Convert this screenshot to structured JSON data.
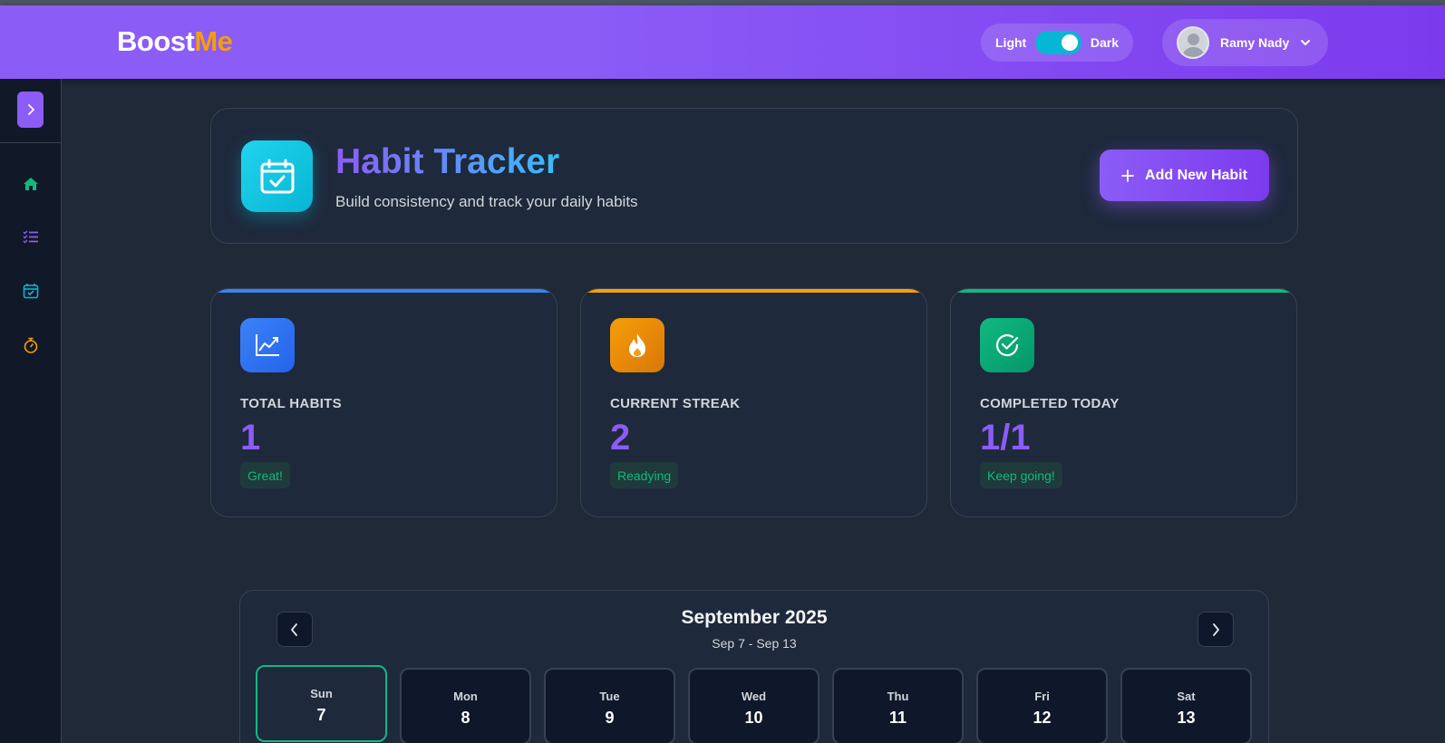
{
  "header": {
    "logo_main": "Boost",
    "logo_accent": "Me",
    "theme_light_label": "Light",
    "theme_dark_label": "Dark",
    "user_name": "Ramy Nady"
  },
  "sidebar": {
    "items": [
      {
        "icon": "home-icon",
        "color": "#10b981"
      },
      {
        "icon": "checklist-icon",
        "color": "#8b5cf6"
      },
      {
        "icon": "calendar-check-icon",
        "color": "#06b6d4"
      },
      {
        "icon": "stopwatch-icon",
        "color": "#f59e0b"
      }
    ]
  },
  "page": {
    "title": "Habit Tracker",
    "subtitle": "Build consistency and track your daily habits",
    "add_button_label": "Add New Habit"
  },
  "stats": [
    {
      "label": "TOTAL HABITS",
      "value": "1",
      "badge": "Great!",
      "icon": "trending-chart-icon",
      "accent": "#3b82f6"
    },
    {
      "label": "CURRENT STREAK",
      "value": "2",
      "badge": "Readying",
      "icon": "flame-icon",
      "accent": "#f59e0b"
    },
    {
      "label": "COMPLETED TODAY",
      "value": "1/1",
      "badge": "Keep going!",
      "icon": "check-circle-icon",
      "accent": "#10b981"
    }
  ],
  "calendar": {
    "month": "September 2025",
    "range": "Sep 7 - Sep 13",
    "days": [
      {
        "name": "Sun",
        "num": "7",
        "selected": true
      },
      {
        "name": "Mon",
        "num": "8"
      },
      {
        "name": "Tue",
        "num": "9"
      },
      {
        "name": "Wed",
        "num": "10"
      },
      {
        "name": "Thu",
        "num": "11"
      },
      {
        "name": "Fri",
        "num": "12"
      },
      {
        "name": "Sat",
        "num": "13"
      }
    ]
  }
}
